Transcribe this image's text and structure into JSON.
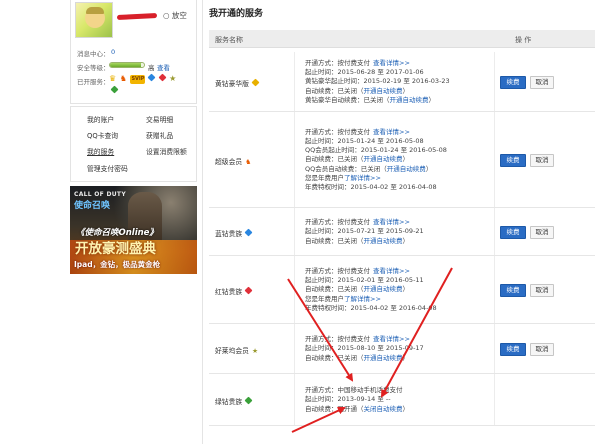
{
  "profile": {
    "nickname": "○ 放空",
    "message_label": "消息中心：",
    "message_count": "0",
    "security_label": "安全等级：",
    "security_level_text": "高",
    "security_upgrade": "查看",
    "security_level_fraction": 0.92,
    "services_label": "已开服务："
  },
  "menu": {
    "items": [
      "我的账户",
      "交易明细",
      "QQ卡查询",
      "获赠礼品",
      "我的服务",
      "设置消费限额",
      "管理支付密码"
    ]
  },
  "banner": {
    "logo_top": "CALL OF DUTY",
    "logo_cn": "使命召唤",
    "line1": "《使命召唤Online》",
    "line2": "开放豪测盛典",
    "line3": "Ipad，金钻，极品黄金枪"
  },
  "main": {
    "title": "我开通的服务",
    "col_service": "服务名称",
    "col_action": "操 作"
  },
  "services": [
    {
      "name": "黄钻豪华版",
      "icon": "yellow-diamond-icon",
      "icon_color": "#e8b000",
      "lines": [
        {
          "t": "开通方式：",
          "v": "按付费支付",
          "link": "查看详情>>"
        },
        {
          "t": "起止时间：",
          "v": "2015-06-28 至 2017-01-06",
          "link": ""
        },
        {
          "t": "黄钻豪华起止时间：",
          "v": "2015-02-19 至 2016-03-23",
          "link": ""
        },
        {
          "t": "自动续费：",
          "v": "已关闭（",
          "link": "开通自动续费",
          "tail": "）"
        },
        {
          "t": "黄钻豪华自动续费：",
          "v": "已关闭（",
          "link": "开通自动续费",
          "tail": "）"
        }
      ],
      "renew": "续费",
      "cancel": "取消"
    },
    {
      "name": "超级会员",
      "icon": "svip-penguin-icon",
      "icon_color": "#e85a00",
      "lines": [
        {
          "t": "开通方式：",
          "v": "按付费支付",
          "link": "查看详情>>"
        },
        {
          "t": "起止时间：",
          "v": "2015-01-24 至 2016-05-08",
          "link": ""
        },
        {
          "t": "QQ会员起止时间：",
          "v": "2015-01-24 至 2016-05-08",
          "link": ""
        },
        {
          "t": "自动续费：",
          "v": "已关闭（",
          "link": "开通自动续费",
          "tail": "）"
        },
        {
          "t": "QQ会员自动续费：",
          "v": "已关闭（",
          "link": "开通自动续费",
          "tail": "）"
        },
        {
          "t": "您是年费用户",
          "v": "",
          "link": "了解详情>>"
        },
        {
          "t": "年费特权时间：",
          "v": "2015-04-02 至 2016-04-08",
          "link": ""
        }
      ],
      "renew": "续费",
      "cancel": "取消"
    },
    {
      "name": "蓝钻贵族",
      "icon": "blue-diamond-icon",
      "icon_color": "#2a86e0",
      "lines": [
        {
          "t": "开通方式：",
          "v": "按付费支付",
          "link": "查看详情>>"
        },
        {
          "t": "起止时间：",
          "v": "2015-07-21 至 2015-09-21",
          "link": ""
        },
        {
          "t": "自动续费：",
          "v": "已关闭（",
          "link": "开通自动续费",
          "tail": "）"
        }
      ],
      "renew": "续费",
      "cancel": "取消"
    },
    {
      "name": "红钻贵族",
      "icon": "red-diamond-icon",
      "icon_color": "#e0303a",
      "lines": [
        {
          "t": "开通方式：",
          "v": "按付费支付",
          "link": "查看详情>>"
        },
        {
          "t": "起止时间：",
          "v": "2015-02-01 至 2016-05-11",
          "link": ""
        },
        {
          "t": "自动续费：",
          "v": "已关闭（",
          "link": "开通自动续费",
          "tail": "）"
        },
        {
          "t": "您是年费用户",
          "v": "",
          "link": "了解详情>>"
        },
        {
          "t": "年费特权时间：",
          "v": "2015-04-02 至 2016-04-08",
          "link": ""
        }
      ],
      "renew": "续费",
      "cancel": "取消"
    },
    {
      "name": "好莱坞会员",
      "icon": "star-icon",
      "icon_color": "#9a9a30",
      "lines": [
        {
          "t": "开通方式：",
          "v": "按付费支付",
          "link": "查看详情>>"
        },
        {
          "t": "起止时间：",
          "v": "2015-08-10 至 2015-09-17",
          "link": ""
        },
        {
          "t": "自动续费：",
          "v": "已关闭（",
          "link": "开通自动续费",
          "tail": "）"
        }
      ],
      "renew": "续费",
      "cancel": "取消"
    },
    {
      "name": "绿钻贵族",
      "icon": "green-diamond-icon",
      "icon_color": "#3aa03a",
      "lines": [
        {
          "t": "开通方式：",
          "v": "中国移动手机话费支付",
          "link": ""
        },
        {
          "t": "起止时间：",
          "v": "2013-09-14 至 --",
          "link": ""
        },
        {
          "t": "自动续费：",
          "v": "已开通（",
          "link": "关闭自动续费",
          "tail": "）"
        }
      ],
      "renew": "",
      "cancel": ""
    }
  ],
  "annotation_color": "#e02020"
}
